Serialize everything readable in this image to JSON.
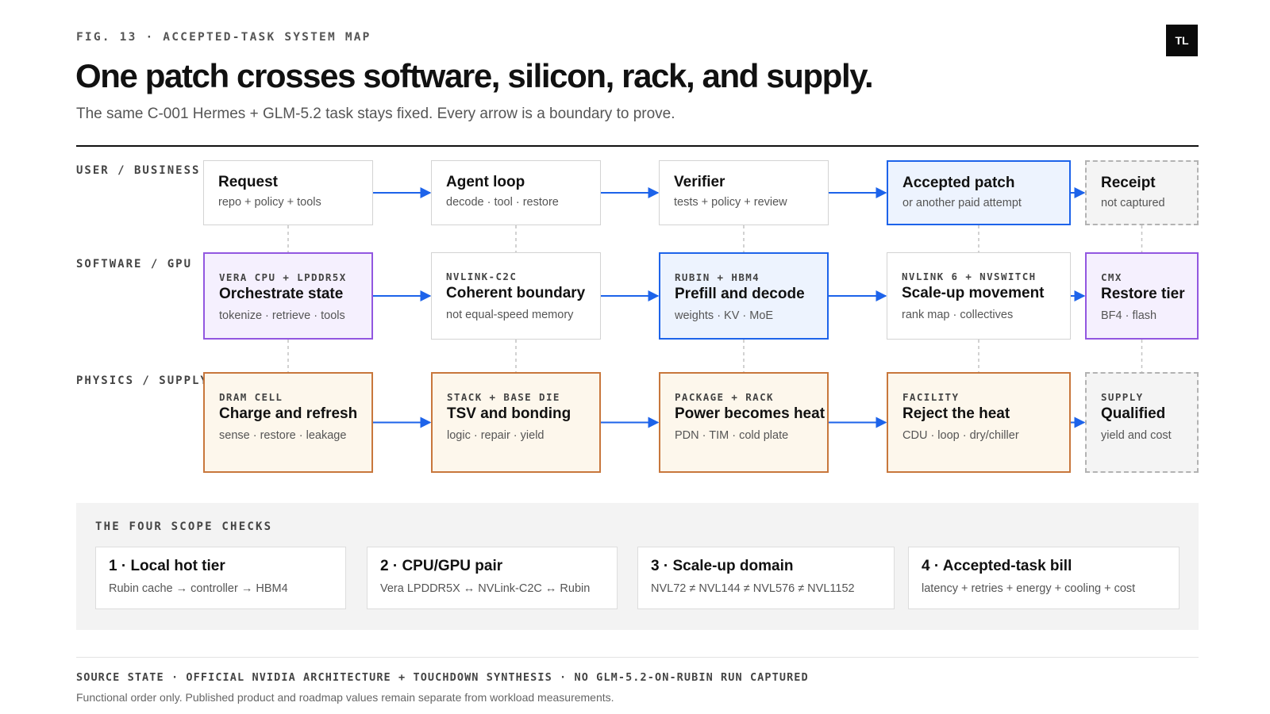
{
  "figure": {
    "label": "FIG. 13 · ACCEPTED-TASK SYSTEM MAP",
    "title": "One patch crosses software, silicon, rack, and supply.",
    "subtitle": "The same C-001 Hermes + GLM-5.2 task stays fixed. Every arrow is a boundary to prove.",
    "logo": "TL"
  },
  "rows": [
    {
      "label": "USER / BUSINESS",
      "nodes": [
        {
          "tag": "",
          "title": "Request",
          "sub": "repo + policy + tools",
          "style": "plain"
        },
        {
          "tag": "",
          "title": "Agent loop",
          "sub": "decode · tool · restore",
          "style": "plain"
        },
        {
          "tag": "",
          "title": "Verifier",
          "sub": "tests + policy + review",
          "style": "plain"
        },
        {
          "tag": "",
          "title": "Accepted patch",
          "sub": "or another paid attempt",
          "style": "blue"
        },
        {
          "tag": "",
          "title": "Receipt",
          "sub": "not captured",
          "style": "dashed"
        }
      ]
    },
    {
      "label": "SOFTWARE / GPU",
      "nodes": [
        {
          "tag": "VERA CPU + LPDDR5X",
          "title": "Orchestrate state",
          "sub": "tokenize · retrieve · tools",
          "style": "purple"
        },
        {
          "tag": "NVLINK-C2C",
          "title": "Coherent boundary",
          "sub": "not equal-speed memory",
          "style": "plain"
        },
        {
          "tag": "RUBIN + HBM4",
          "title": "Prefill and decode",
          "sub": "weights · KV · MoE",
          "style": "blue"
        },
        {
          "tag": "NVLINK 6 + NVSWITCH",
          "title": "Scale-up movement",
          "sub": "rank map · collectives",
          "style": "plain"
        },
        {
          "tag": "CMX",
          "title": "Restore tier",
          "sub": "BF4 · flash",
          "style": "purple"
        }
      ]
    },
    {
      "label": "PHYSICS / SUPPLY",
      "nodes": [
        {
          "tag": "DRAM CELL",
          "title": "Charge and refresh",
          "sub": "sense · restore · leakage",
          "style": "orange"
        },
        {
          "tag": "STACK + BASE DIE",
          "title": "TSV and bonding",
          "sub": "logic · repair · yield",
          "style": "orange"
        },
        {
          "tag": "PACKAGE + RACK",
          "title": "Power becomes heat",
          "sub": "PDN · TIM · cold plate",
          "style": "orange"
        },
        {
          "tag": "FACILITY",
          "title": "Reject the heat",
          "sub": "CDU · loop · dry/chiller",
          "style": "orange"
        },
        {
          "tag": "SUPPLY",
          "title": "Qualified",
          "sub": "yield and cost",
          "style": "dashed"
        }
      ]
    }
  ],
  "scope_checks": {
    "label": "THE FOUR SCOPE CHECKS",
    "items": [
      {
        "title": "1 · Local hot tier",
        "sub": "Rubin cache → controller → HBM4"
      },
      {
        "title": "2 · CPU/GPU pair",
        "sub": "Vera LPDDR5X ↔ NVLink-C2C ↔ Rubin"
      },
      {
        "title": "3 · Scale-up domain",
        "sub": "NVL72 ≠ NVL144 ≠ NVL576 ≠ NVL1152"
      },
      {
        "title": "4 · Accepted-task bill",
        "sub": "latency + retries + energy + cooling + cost"
      }
    ]
  },
  "footer": {
    "source": "SOURCE STATE · OFFICIAL NVIDIA ARCHITECTURE + TOUCHDOWN SYNTHESIS · NO GLM-5.2-ON-RUBIN RUN CAPTURED",
    "note": "Functional order only. Published product and roadmap values remain separate from workload measurements."
  },
  "colors": {
    "arrow": "#1d63ea",
    "blue_border": "#1d63ea",
    "blue_fill": "#edf3fe",
    "purple_border": "#9257e0",
    "purple_fill": "#f5f0fe",
    "orange_border": "#c8773c",
    "orange_fill": "#fdf7ec",
    "dashed_border": "#b3b3b3"
  }
}
